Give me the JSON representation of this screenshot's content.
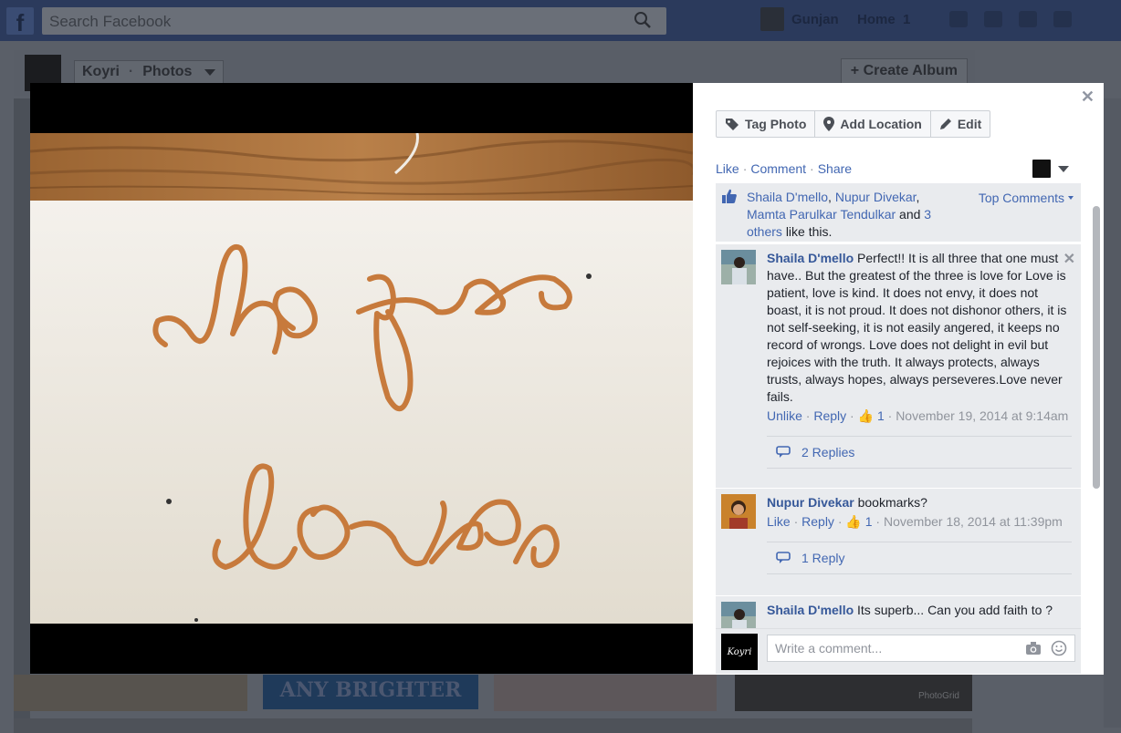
{
  "topbar": {
    "logo": "f",
    "search_placeholder": "Search Facebook",
    "user_name": "Gunjan",
    "home_label": "Home",
    "home_count": "1"
  },
  "page_header": {
    "page_name": "Koyri",
    "section": "Photos",
    "create_album": "+ Create Album"
  },
  "background": {
    "tile_text": "ANY BRIGHTER",
    "watermark": "PhotoGrid"
  },
  "photo": {
    "word_top": "hope",
    "word_bottom": "love"
  },
  "panel": {
    "actions": [
      {
        "label": "Tag Photo",
        "icon": "tag-icon"
      },
      {
        "label": "Add Location",
        "icon": "location-pin-icon"
      },
      {
        "label": "Edit",
        "icon": "pencil-icon"
      }
    ],
    "like_label": "Like",
    "comment_label": "Comment",
    "share_label": "Share",
    "sep": "·",
    "likes": {
      "name1": "Shaila D'mello",
      "name2": "Nupur Divekar",
      "name3": "Mamta Parulkar Tendulkar",
      "and_text": "and",
      "others_link": "3 others",
      "suffix": "like this."
    },
    "top_comments": "Top Comments",
    "comments": [
      {
        "author": "Shaila D'mello",
        "text": "Perfect!! It is all three that one must have.. But the greatest of the three is love for Love is patient, love is kind. It does not envy, it does not boast, it is not proud. It does not dishonor others, it is not self-seeking, it is not easily angered, it keeps no record of wrongs. Love does not delight in evil but rejoices with the truth. It always protects, always trusts, always hopes, always perseveres.Love never fails.",
        "action": "Unlike",
        "reply": "Reply",
        "likes": "1",
        "timestamp": "November 19, 2014 at 9:14am",
        "replies": "2 Replies"
      },
      {
        "author": "Nupur Divekar",
        "text": "bookmarks?",
        "action": "Like",
        "reply": "Reply",
        "likes": "1",
        "timestamp": "November 18, 2014 at 11:39pm",
        "replies": "1 Reply"
      },
      {
        "author": "Shaila D'mello",
        "text": "Its superb... Can you add faith to ?"
      }
    ],
    "composer": {
      "avatar_text": "Koyri",
      "placeholder": "Write a comment..."
    }
  }
}
